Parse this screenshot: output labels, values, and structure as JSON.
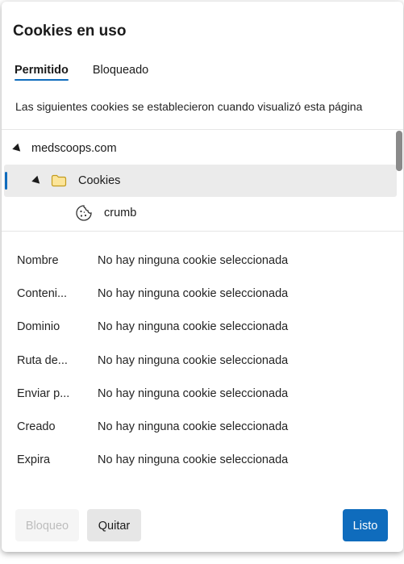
{
  "dialog": {
    "title": "Cookies en uso",
    "tabs": [
      {
        "label": "Permitido",
        "active": true
      },
      {
        "label": "Bloqueado",
        "active": false
      }
    ],
    "description": "Las siguientes cookies se establecieron cuando visualizó esta página"
  },
  "tree": {
    "site": "medscoops.com",
    "folder": "Cookies",
    "cookie": "crumb"
  },
  "details": [
    {
      "label": "Nombre",
      "value": "No hay ninguna cookie seleccionada"
    },
    {
      "label": "Conteni...",
      "value": "No hay ninguna cookie seleccionada"
    },
    {
      "label": "Dominio",
      "value": "No hay ninguna cookie seleccionada"
    },
    {
      "label": "Ruta de...",
      "value": "No hay ninguna cookie seleccionada"
    },
    {
      "label": "Enviar p...",
      "value": "No hay ninguna cookie seleccionada"
    },
    {
      "label": "Creado",
      "value": "No hay ninguna cookie seleccionada"
    },
    {
      "label": "Expira",
      "value": "No hay ninguna cookie seleccionada"
    }
  ],
  "buttons": {
    "block": "Bloqueo",
    "remove": "Quitar",
    "done": "Listo"
  },
  "colors": {
    "accent": "#0f6cbd",
    "selected_row": "#ebebeb"
  }
}
